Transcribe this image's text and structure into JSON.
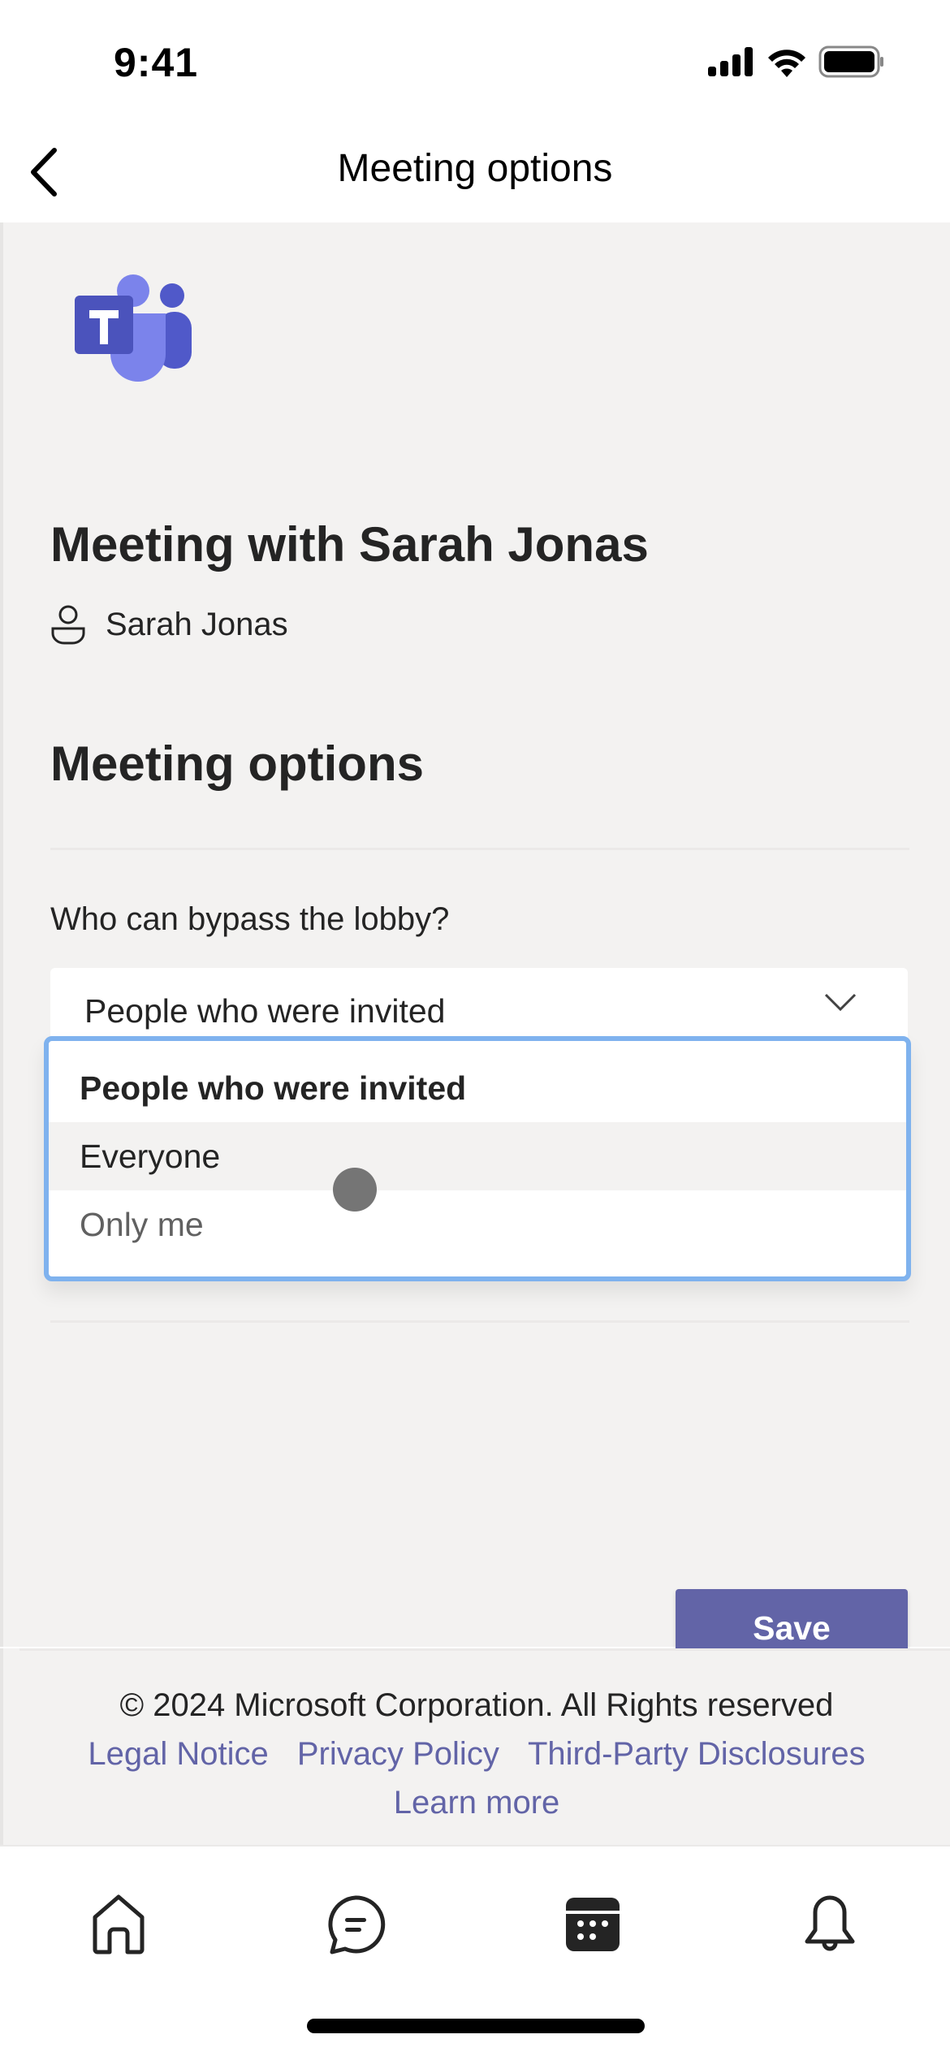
{
  "status_bar": {
    "time": "9:41",
    "icons": [
      "cellular-signal-icon",
      "wifi-icon",
      "battery-icon"
    ]
  },
  "nav": {
    "title": "Meeting options",
    "back_icon": "chevron-left-icon"
  },
  "app": {
    "logo": "microsoft-teams-logo",
    "brand_color": "#6264a7",
    "focus_color": "#7fb2ee"
  },
  "meeting": {
    "title": "Meeting with Sarah Jonas",
    "organizer": "Sarah Jonas",
    "organizer_icon": "person-icon"
  },
  "options": {
    "section_title": "Meeting options",
    "lobby": {
      "label": "Who can bypass the lobby?",
      "selected": "People who were invited",
      "chevron_icon": "chevron-down-icon",
      "items": [
        {
          "label": "People who were invited",
          "state": "selected"
        },
        {
          "label": "Everyone",
          "state": "hovered"
        },
        {
          "label": "Only me",
          "state": "normal"
        }
      ]
    },
    "save_label": "Save"
  },
  "footer": {
    "copyright": "© 2024 Microsoft Corporation. All Rights reserved",
    "links": [
      "Legal Notice",
      "Privacy Policy",
      "Third-Party Disclosures"
    ],
    "learn_more": "Learn more"
  },
  "tab_bar": {
    "tabs": [
      {
        "name": "home",
        "icon": "home-icon",
        "active": false
      },
      {
        "name": "chat",
        "icon": "chat-icon",
        "active": false
      },
      {
        "name": "calendar",
        "icon": "calendar-icon",
        "active": true
      },
      {
        "name": "activity",
        "icon": "bell-icon",
        "active": false
      }
    ]
  }
}
